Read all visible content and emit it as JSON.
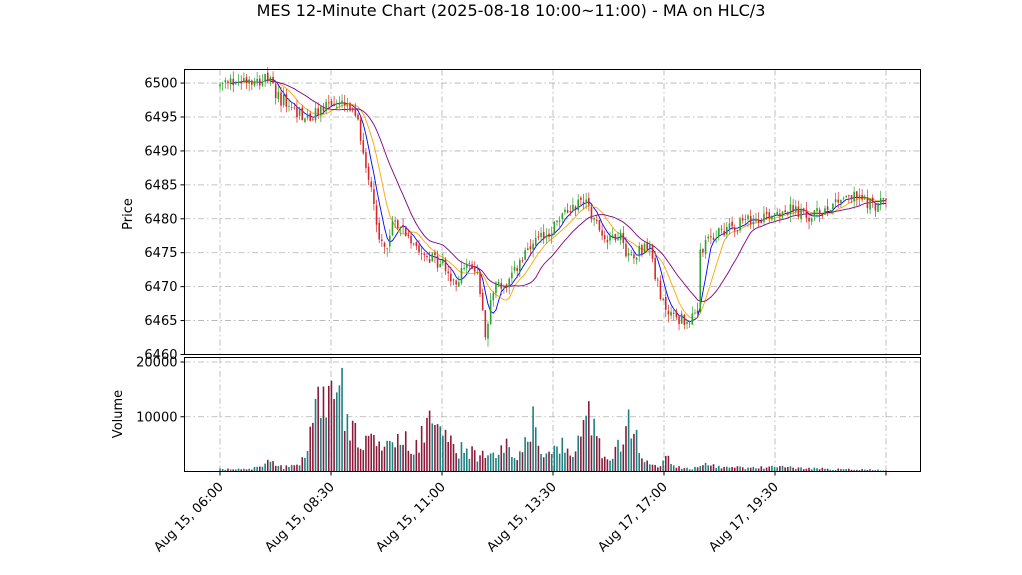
{
  "chart_data": {
    "type": "candlestick",
    "title": "MES 12-Minute Chart (2025-08-18 10:00~11:00) - MA on HLC/3",
    "price_panel": {
      "ylabel": "Price",
      "ylim": [
        6460,
        6502
      ],
      "yticks": [
        "6460",
        "6465",
        "6470",
        "6475",
        "6480",
        "6485",
        "6490",
        "6495",
        "6500"
      ]
    },
    "volume_panel": {
      "ylabel": "Volume",
      "ylim": [
        0,
        20000
      ],
      "yticks": [
        "10000",
        "20000"
      ]
    },
    "xticks": [
      "Aug 15, 06:00",
      "Aug 15, 08:30",
      "Aug 15, 11:00",
      "Aug 15, 13:30",
      "Aug 17, 17:00",
      "Aug 17, 19:30"
    ],
    "grid": true,
    "colors": {
      "up": "#2ca02c",
      "down": "#d62728",
      "ma_fast": "#0000ff",
      "ma_mid": "#ffa500",
      "ma_slow": "#800080",
      "vol_up": "#1f7f7f",
      "vol_down": "#8b1a3a"
    },
    "price_anchors": [
      [
        0,
        6499.5
      ],
      [
        10,
        6500.8
      ],
      [
        18,
        6500.5
      ],
      [
        22,
        6498
      ],
      [
        28,
        6496
      ],
      [
        34,
        6494.5
      ],
      [
        40,
        6497
      ],
      [
        48,
        6496.5
      ],
      [
        52,
        6494
      ],
      [
        55,
        6488
      ],
      [
        57,
        6485
      ],
      [
        60,
        6477
      ],
      [
        63,
        6476
      ],
      [
        66,
        6480
      ],
      [
        70,
        6478
      ],
      [
        75,
        6476
      ],
      [
        80,
        6474
      ],
      [
        85,
        6473
      ],
      [
        88,
        6470
      ],
      [
        92,
        6473
      ],
      [
        97,
        6472
      ],
      [
        100,
        6463.5
      ],
      [
        104,
        6471
      ],
      [
        108,
        6469.5
      ],
      [
        112,
        6473
      ],
      [
        118,
        6476
      ],
      [
        124,
        6478
      ],
      [
        128,
        6480
      ],
      [
        133,
        6482
      ],
      [
        138,
        6483
      ],
      [
        142,
        6479
      ],
      [
        146,
        6477
      ],
      [
        150,
        6478
      ],
      [
        154,
        6474.5
      ],
      [
        158,
        6475.5
      ],
      [
        162,
        6476
      ],
      [
        166,
        6468
      ],
      [
        170,
        6466
      ],
      [
        175,
        6465
      ],
      [
        180,
        6465.5
      ],
      [
        181,
        6475
      ],
      [
        186,
        6477.5
      ],
      [
        192,
        6479
      ],
      [
        198,
        6479.5
      ],
      [
        205,
        6480.5
      ],
      [
        212,
        6481.5
      ],
      [
        218,
        6481
      ],
      [
        222,
        6480
      ],
      [
        228,
        6481.5
      ],
      [
        235,
        6483.5
      ],
      [
        242,
        6483
      ],
      [
        246,
        6482
      ],
      [
        250,
        6482.5
      ]
    ],
    "volume_anchors": [
      [
        0,
        400
      ],
      [
        10,
        500
      ],
      [
        16,
        900
      ],
      [
        18,
        1800
      ],
      [
        24,
        800
      ],
      [
        27,
        1500
      ],
      [
        30,
        1200
      ],
      [
        34,
        6500
      ],
      [
        36,
        11000
      ],
      [
        38,
        17000
      ],
      [
        40,
        11000
      ],
      [
        42,
        19000
      ],
      [
        44,
        11000
      ],
      [
        46,
        18000
      ],
      [
        48,
        8000
      ],
      [
        50,
        7500
      ],
      [
        55,
        6500
      ],
      [
        60,
        5000
      ],
      [
        65,
        4500
      ],
      [
        70,
        6000
      ],
      [
        74,
        4500
      ],
      [
        78,
        11000
      ],
      [
        80,
        12000
      ],
      [
        82,
        9500
      ],
      [
        84,
        7000
      ],
      [
        88,
        4500
      ],
      [
        95,
        3500
      ],
      [
        100,
        3000
      ],
      [
        105,
        2500
      ],
      [
        108,
        6800
      ],
      [
        112,
        2500
      ],
      [
        118,
        9000
      ],
      [
        122,
        3000
      ],
      [
        128,
        5500
      ],
      [
        132,
        2500
      ],
      [
        138,
        9000
      ],
      [
        141,
        12500
      ],
      [
        144,
        3500
      ],
      [
        148,
        3000
      ],
      [
        152,
        7500
      ],
      [
        154,
        9000
      ],
      [
        156,
        12500
      ],
      [
        158,
        4500
      ],
      [
        162,
        1500
      ],
      [
        166,
        900
      ],
      [
        168,
        3500
      ],
      [
        170,
        1200
      ],
      [
        175,
        700
      ],
      [
        180,
        600
      ],
      [
        182,
        1500
      ],
      [
        190,
        800
      ],
      [
        200,
        700
      ],
      [
        210,
        900
      ],
      [
        220,
        600
      ],
      [
        230,
        500
      ],
      [
        240,
        400
      ],
      [
        250,
        300
      ]
    ]
  }
}
